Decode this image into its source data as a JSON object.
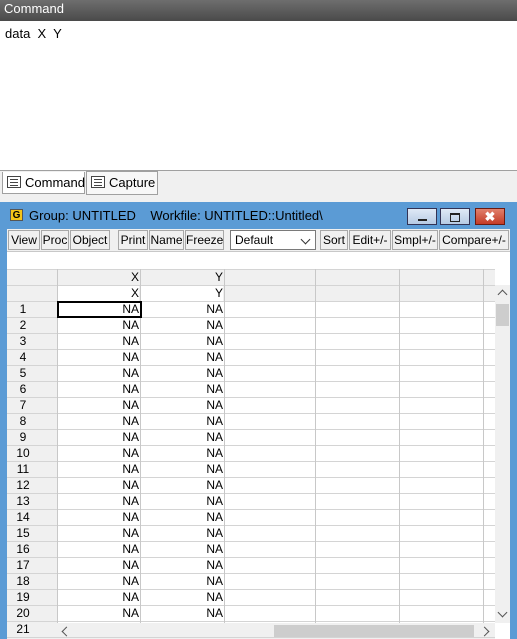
{
  "command_window": {
    "title": "Command",
    "command_text": "data  X  Y",
    "tabs": [
      {
        "label": "Command",
        "active": true
      },
      {
        "label": "Capture",
        "active": false
      }
    ]
  },
  "group_window": {
    "icon_letter": "G",
    "title": "Group: UNTITLED    Workfile: UNTITLED::Untitled\\",
    "buttons": {
      "minimize": "minimize",
      "maximize": "maximize",
      "close": "✖"
    },
    "toolbar": {
      "view": "View",
      "proc": "Proc",
      "object": "Object",
      "print": "Print",
      "name": "Name",
      "freeze": "Freeze",
      "display_select": "Default",
      "sort": "Sort",
      "edit": "Edit+/-",
      "smpl": "Smpl+/-",
      "compare": "Compare+/-"
    },
    "columns": [
      "X",
      "Y"
    ],
    "column_subheaders": [
      "X",
      "Y"
    ],
    "rows": [
      {
        "obs": "1",
        "x": "NA",
        "y": "NA"
      },
      {
        "obs": "2",
        "x": "NA",
        "y": "NA"
      },
      {
        "obs": "3",
        "x": "NA",
        "y": "NA"
      },
      {
        "obs": "4",
        "x": "NA",
        "y": "NA"
      },
      {
        "obs": "5",
        "x": "NA",
        "y": "NA"
      },
      {
        "obs": "6",
        "x": "NA",
        "y": "NA"
      },
      {
        "obs": "7",
        "x": "NA",
        "y": "NA"
      },
      {
        "obs": "8",
        "x": "NA",
        "y": "NA"
      },
      {
        "obs": "9",
        "x": "NA",
        "y": "NA"
      },
      {
        "obs": "10",
        "x": "NA",
        "y": "NA"
      },
      {
        "obs": "11",
        "x": "NA",
        "y": "NA"
      },
      {
        "obs": "12",
        "x": "NA",
        "y": "NA"
      },
      {
        "obs": "13",
        "x": "NA",
        "y": "NA"
      },
      {
        "obs": "14",
        "x": "NA",
        "y": "NA"
      },
      {
        "obs": "15",
        "x": "NA",
        "y": "NA"
      },
      {
        "obs": "16",
        "x": "NA",
        "y": "NA"
      },
      {
        "obs": "17",
        "x": "NA",
        "y": "NA"
      },
      {
        "obs": "18",
        "x": "NA",
        "y": "NA"
      },
      {
        "obs": "19",
        "x": "NA",
        "y": "NA"
      },
      {
        "obs": "20",
        "x": "NA",
        "y": "NA"
      },
      {
        "obs": "21",
        "x": "",
        "y": ""
      }
    ]
  }
}
